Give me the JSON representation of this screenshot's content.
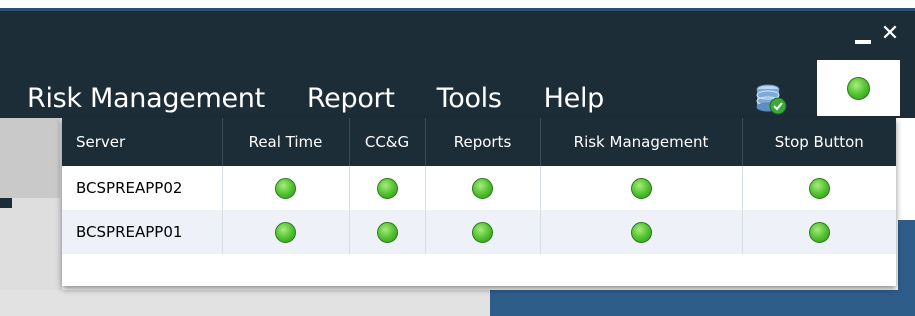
{
  "window": {
    "minimize_icon": "minimize-icon",
    "close_icon": "close-icon",
    "close_glyph": "✕"
  },
  "menu": {
    "items": [
      {
        "label": "Risk Management"
      },
      {
        "label": "Report"
      },
      {
        "label": "Tools"
      },
      {
        "label": "Help"
      }
    ],
    "db_icon": "database-check-icon",
    "status_icon": "green-status-icon"
  },
  "server_status": {
    "columns": [
      "Server",
      "Real Time",
      "CC&G",
      "Reports",
      "Risk Management",
      "Stop Button"
    ],
    "rows": [
      {
        "server": "BCSPREAPP02",
        "statuses": [
          "green",
          "green",
          "green",
          "green",
          "green"
        ]
      },
      {
        "server": "BCSPREAPP01",
        "statuses": [
          "green",
          "green",
          "green",
          "green",
          "green"
        ]
      }
    ]
  },
  "colors": {
    "app_bar": "#1d2d38",
    "status_green": "#53c332",
    "accent_blue": "#2f5d8a"
  }
}
